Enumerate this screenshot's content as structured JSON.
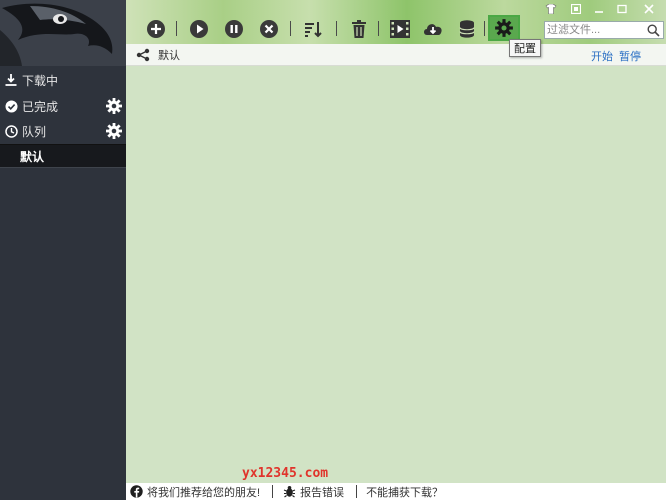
{
  "sidebar": {
    "items": [
      {
        "label": "下载中"
      },
      {
        "label": "已完成"
      },
      {
        "label": "队列"
      }
    ],
    "queue_sub": "默认"
  },
  "toolbar": {
    "tooltip": "配置"
  },
  "search": {
    "placeholder": "过滤文件..."
  },
  "header": {
    "title": "默认",
    "start": "开始",
    "pause": "暂停"
  },
  "watermark": "yx12345.com",
  "footer": {
    "recommend": "将我们推荐给您的朋友!",
    "report": "报告错误",
    "capture": "不能捕获下载？"
  },
  "colors": {
    "sidebar_bg": "#2e333c",
    "main_bg": "#d1e3c5",
    "accent_green": "#5aa84e",
    "link_blue": "#2a6fc4",
    "watermark_red": "#e0332b"
  }
}
